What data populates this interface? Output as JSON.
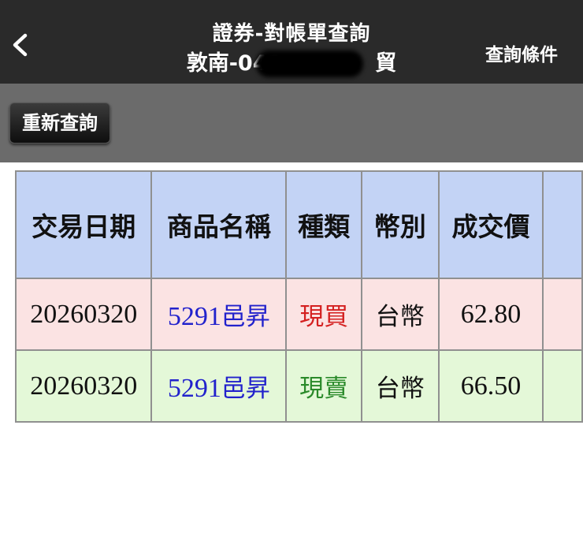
{
  "header": {
    "back_icon": "chevron-left-icon",
    "title": "證券-對帳單查詢",
    "account_prefix": "敦南-041",
    "account_suffix": "貿",
    "query_conditions": "查詢條件"
  },
  "toolbar": {
    "requery_label": "重新查詢"
  },
  "table": {
    "columns": [
      "交易日期",
      "商品名稱",
      "種類",
      "幣別",
      "成交價"
    ],
    "rows": [
      {
        "date": "20260320",
        "code": "5291",
        "name": "邑昇",
        "type": "現買",
        "currency": "台幣",
        "price": "62.80"
      },
      {
        "date": "20260320",
        "code": "5291",
        "name": "邑昇",
        "type": "現賣",
        "currency": "台幣",
        "price": "66.50"
      }
    ]
  },
  "colors": {
    "header_bg": "#2a2a2a",
    "toolbar_bg": "#6b6b6b",
    "column_header_bg": "#c3d3f5",
    "buy_row_bg": "#fbe3e3",
    "sell_row_bg": "#e4f8d8",
    "buy_text": "#d42020",
    "sell_text": "#2a8a2a",
    "product_text": "#2222cc"
  }
}
